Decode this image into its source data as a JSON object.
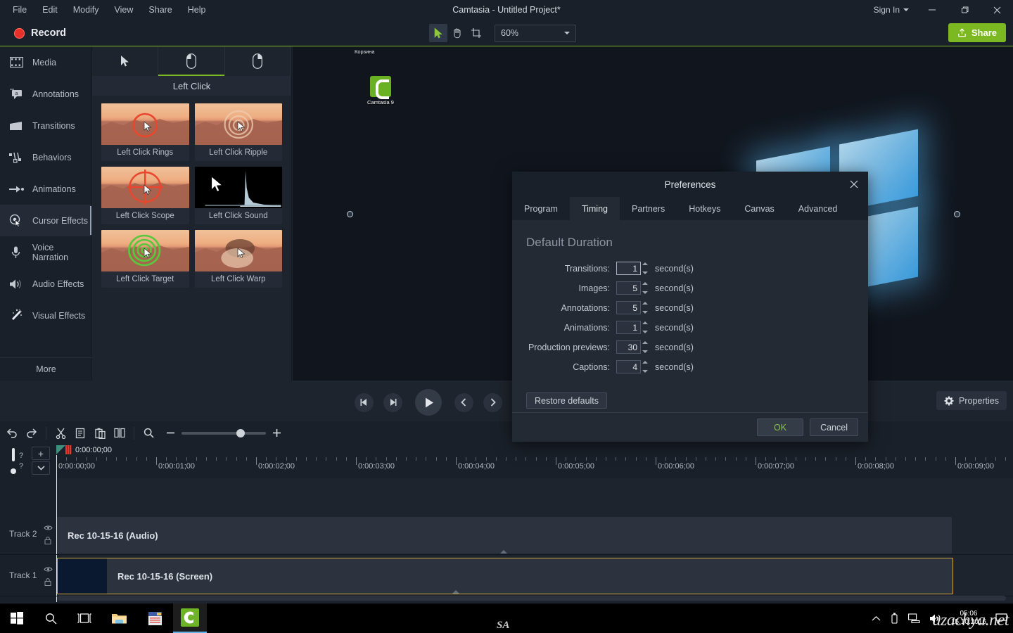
{
  "window": {
    "title": "Camtasia - Untitled Project*",
    "signin": "Sign In",
    "minimize_icon": "minimize-icon",
    "maximize_icon": "maximize-icon",
    "close_icon": "close-icon"
  },
  "menu": [
    "File",
    "Edit",
    "Modify",
    "View",
    "Share",
    "Help"
  ],
  "toolbar": {
    "record_label": "Record",
    "share_label": "Share",
    "zoom_value": "60%",
    "tools": [
      {
        "name": "select-tool",
        "icon": "cursor-arrow-icon",
        "active": true
      },
      {
        "name": "hand-tool",
        "icon": "hand-icon",
        "active": false
      },
      {
        "name": "crop-tool",
        "icon": "crop-icon",
        "active": false
      }
    ]
  },
  "sidebar": {
    "items": [
      {
        "label": "Media",
        "icon": "film-strip-icon",
        "active": false
      },
      {
        "label": "Annotations",
        "icon": "callout-icon",
        "active": false
      },
      {
        "label": "Transitions",
        "icon": "transition-icon",
        "active": false
      },
      {
        "label": "Behaviors",
        "icon": "behaviors-icon",
        "active": false
      },
      {
        "label": "Animations",
        "icon": "arrow-animation-icon",
        "active": false
      },
      {
        "label": "Cursor Effects",
        "icon": "cursor-effects-icon",
        "active": true
      },
      {
        "label": "Voice Narration",
        "icon": "microphone-icon",
        "active": false
      },
      {
        "label": "Audio Effects",
        "icon": "speaker-icon",
        "active": false
      },
      {
        "label": "Visual Effects",
        "icon": "magic-wand-icon",
        "active": false
      }
    ],
    "more_label": "More"
  },
  "effects_panel": {
    "tabs": [
      {
        "name": "cursor-tab",
        "icon": "cursor-arrow-icon",
        "active": false
      },
      {
        "name": "left-click-tab",
        "icon": "mouse-left-icon",
        "active": true
      },
      {
        "name": "right-click-tab",
        "icon": "mouse-right-icon",
        "active": false
      }
    ],
    "header": "Left Click",
    "effects": [
      {
        "label": "Left Click Rings",
        "thumb": "dune",
        "ring_color": "#e8472e"
      },
      {
        "label": "Left Click Ripple",
        "thumb": "dune",
        "ring_color": ""
      },
      {
        "label": "Left Click Scope",
        "thumb": "dune",
        "ring_color": "#e8472e"
      },
      {
        "label": "Left Click Sound",
        "thumb": "black",
        "ring_color": ""
      },
      {
        "label": "Left Click Target",
        "thumb": "dune",
        "ring_color": "#5ac83c"
      },
      {
        "label": "Left Click Warp",
        "thumb": "dune",
        "ring_color": ""
      }
    ]
  },
  "canvas": {
    "desktop_recycle_label": "Корзина",
    "desktop_icon_label": "Camtasia 9"
  },
  "playback": {
    "buttons": [
      {
        "name": "previous-frame-button",
        "icon": "step-back-icon"
      },
      {
        "name": "next-frame-button",
        "icon": "step-forward-icon"
      },
      {
        "name": "play-button",
        "icon": "play-icon"
      },
      {
        "name": "prev-marker-button",
        "icon": "chevron-left-icon"
      },
      {
        "name": "next-marker-button",
        "icon": "chevron-right-icon"
      }
    ],
    "properties_label": "Properties"
  },
  "edit_toolbar": {
    "buttons": [
      {
        "name": "undo-button",
        "icon": "undo-icon"
      },
      {
        "name": "redo-button",
        "icon": "redo-icon"
      },
      {
        "name": "cut-button",
        "icon": "scissors-icon"
      },
      {
        "name": "copy-button",
        "icon": "copy-icon"
      },
      {
        "name": "paste-button",
        "icon": "paste-icon"
      },
      {
        "name": "split-button",
        "icon": "split-icon"
      },
      {
        "name": "zoom-label-icon",
        "icon": "magnifier-icon"
      }
    ],
    "zoom_out_icon": "minus-icon",
    "zoom_in_icon": "plus-icon"
  },
  "timeline": {
    "playhead_time": "0:00:00;00",
    "add_track_icon": "plus-icon",
    "collapse_icon": "chevron-down-icon",
    "ruler_labels": [
      "0:00:00;00",
      "0:00:01;00",
      "0:00:02;00",
      "0:00:03;00",
      "0:00:04;00",
      "0:00:05;00",
      "0:00:06;00",
      "0:00:07;00",
      "0:00:08;00",
      "0:00:09;00"
    ],
    "tracks": [
      {
        "name": "Track 2",
        "clip_title": "Rec 10-15-16 (Audio)",
        "selected": false,
        "has_thumb": false
      },
      {
        "name": "Track 1",
        "clip_title": "Rec 10-15-16 (Screen)",
        "selected": true,
        "has_thumb": true
      }
    ]
  },
  "dialog": {
    "title": "Preferences",
    "close_icon": "close-icon",
    "tabs": [
      {
        "label": "Program",
        "active": false
      },
      {
        "label": "Timing",
        "active": true
      },
      {
        "label": "Partners",
        "active": false
      },
      {
        "label": "Hotkeys",
        "active": false
      },
      {
        "label": "Canvas",
        "active": false
      },
      {
        "label": "Advanced",
        "active": false
      }
    ],
    "section_title": "Default Duration",
    "fields": [
      {
        "label": "Transitions:",
        "value": "1",
        "unit": "second(s)",
        "focused": true
      },
      {
        "label": "Images:",
        "value": "5",
        "unit": "second(s)",
        "focused": false
      },
      {
        "label": "Annotations:",
        "value": "5",
        "unit": "second(s)",
        "focused": false
      },
      {
        "label": "Animations:",
        "value": "1",
        "unit": "second(s)",
        "focused": false
      },
      {
        "label": "Production previews:",
        "value": "30",
        "unit": "second(s)",
        "focused": false
      },
      {
        "label": "Captions:",
        "value": "4",
        "unit": "second(s)",
        "focused": false
      }
    ],
    "restore_label": "Restore defaults",
    "ok_label": "OK",
    "cancel_label": "Cancel"
  },
  "taskbar": {
    "items": [
      {
        "name": "start-button",
        "icon": "windows-logo-icon"
      },
      {
        "name": "search-button",
        "icon": "magnifier-icon"
      },
      {
        "name": "task-view-button",
        "icon": "task-view-icon"
      },
      {
        "name": "file-explorer-button",
        "icon": "folder-icon"
      },
      {
        "name": "store-button",
        "icon": "store-icon"
      },
      {
        "name": "camtasia-button",
        "icon": "camtasia-icon"
      }
    ],
    "tray_icons": [
      "chevron-up-icon",
      "usb-icon",
      "network-icon",
      "volume-icon"
    ],
    "clock_time": "05:06",
    "clock_date": "15.10.2016",
    "watermark": "azachya.net",
    "sa_mark": "SA"
  },
  "colors": {
    "accent_green": "#7cb821",
    "record_red": "#e8302a",
    "selected_clip": "#d2a93c",
    "ok_green": "#8cc63f"
  }
}
